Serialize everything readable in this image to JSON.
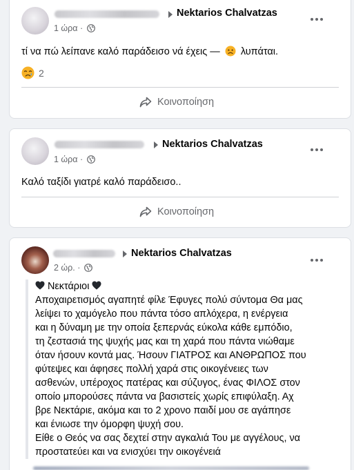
{
  "posts": [
    {
      "group": "Nektarios Chalvatzas",
      "time": "1 ώρα",
      "dot": "·",
      "text": "τί να πώ λείπανε καλό παράδεισο νά έχεις —",
      "text_tail": "λυπάται.",
      "reaction_count": "2",
      "share_label": "Κοινοποίηση"
    },
    {
      "group": "Nektarios Chalvatzas",
      "time": "1 ώρα",
      "dot": "·",
      "text": "Καλό ταξίδι γιατρέ καλό παράδεισο..",
      "share_label": "Κοινοποίηση"
    },
    {
      "group": "Nektarios Chalvatzas",
      "time": "2 ώρ.",
      "dot": "·",
      "lines": [
        "Νεκτάριοι",
        "Αποχαιρετισμός αγαπητέ φίλε Έφυγες πολύ σύντομα Θα μας",
        "λείψει το χαμόγελο που πάντα τόσο απλόχερα, η ενέργεια",
        "και η δύναμη με την οποία ξεπερνάς εύκολα κάθε εμπόδιο,",
        "τη ζεστασιά της ψυχής μας και τη χαρά που πάντα νιώθαμε",
        "όταν ήσουν κοντά μας. Ήσουν ΓΙΑΤΡΟΣ και ΑΝΘΡΩΠΟΣ που",
        "φύτεψες και άφησες πολλή χαρά στις οικογένειες των",
        "ασθενών, υπέροχος πατέρας και σύζυγος, ένας ΦΙΛΟΣ στον",
        "οποίο μπορούσες πάντα να βασιστείς χωρίς επιφύλαξη. Αχ",
        "βρε Νεκτάριε, ακόμα και το 2 χρονο παιδί μου σε αγάπησε",
        "και ένιωσε την όμορφη ψυχή σου.",
        "Είθε ο Θεός να σας δεχτεί στην αγκαλιά Του με αγγέλους, να",
        "προστατεύει και να ενισχύει την οικογένειά"
      ]
    }
  ],
  "icons": {
    "sad_reaction": "crying-face",
    "inline_emoji": "sad-face",
    "heart": "black-heart",
    "globe": "globe-icon",
    "share": "share-arrow-icon",
    "more": "more-options-icon"
  },
  "colors": {
    "background": "#f0f2f5",
    "secondary_text": "#65676b",
    "reaction_yellow": "#f7b125"
  }
}
